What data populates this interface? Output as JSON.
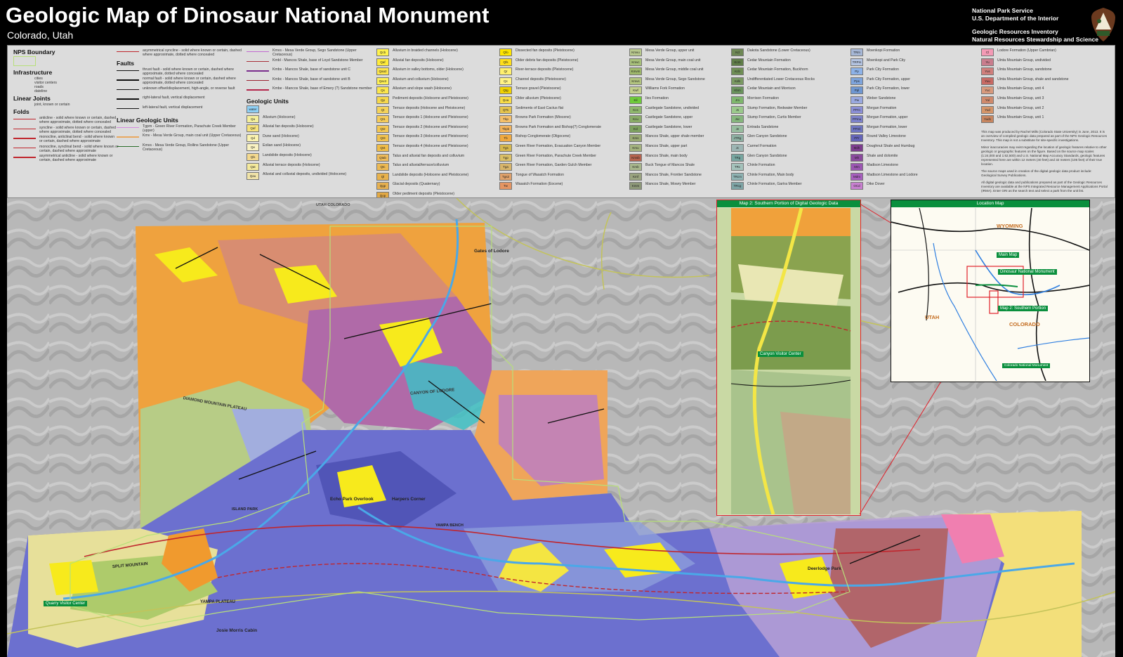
{
  "header": {
    "title": "Geologic Map of Dinosaur National Monument",
    "subtitle": "Colorado, Utah",
    "agency": [
      "National Park Service",
      "U.S. Department of the Interior",
      "",
      "Geologic Resources Inventory",
      "Natural Resources Stewardship and Science"
    ]
  },
  "legend": {
    "nps_boundary": "NPS Boundary",
    "infrastructure": "Infrastructure",
    "infra_items": [
      "cities",
      "visitor centers",
      "roads",
      "dateline"
    ],
    "linear_joints": "Linear Joints",
    "joint_item": "joint, known or certain",
    "folds": "Folds",
    "fold_items": [
      "anticline - solid where known or certain, dashed where approximate, dotted where concealed",
      "syncline - solid where known or certain, dashed where approximate, dotted where concealed",
      "monocline, anticlinal bend - solid where known or certain, dashed where approximate",
      "monocline, synclinal bend - solid where known or certain, dashed where approximate",
      "asymmetrical anticline - solid where known or certain, dashed where approximate"
    ],
    "fold_cont": "asymmetrical syncline - solid where known or certain, dashed where approximate, dotted where concealed",
    "faults": "Faults",
    "fault_items": [
      "thrust fault - solid where known or certain, dashed where approximate, dotted where concealed",
      "normal fault - solid where known or certain, dashed where approximate, dotted where concealed",
      "unknown offset/displacement, high-angle, or reverse fault",
      "right-lateral fault, vertical displacement",
      "left-lateral fault, vertical displacement"
    ],
    "linear_units": "Linear Geologic Units",
    "linear_unit_items": [
      "Tgpm - Green River Formation, Parachute Creek Member (upper)",
      "Kmv - Mesa Verde Group, main coal unit (Upper Cretaceous)",
      "Kmvs - Mesa Verde Group, Rollins Sandstone (Upper Cretaceous)"
    ],
    "col3_items": [
      "Kmvs - Mesa Verde Group, Sego Sandstone (Upper Cretaceous)",
      "Kmbl - Mancos Shale, base of Loyd Sandstone Member",
      "Kmbs - Mancos Shale, base of sandstone unit C",
      "Kmbc - Mancos Shale, base of sandstone unit B",
      "Kmbe - Mancos Shale, base of Emery (?) Sandstone member"
    ],
    "geologic_units": "Geologic Units",
    "water": "water",
    "units_a": [
      {
        "code": "Qa",
        "label": "Alluvium (Holocene)",
        "color": "#f5ef9b"
      },
      {
        "code": "Qaf",
        "label": "Alluvial fan deposits (Holocene)",
        "color": "#f7e37a"
      },
      {
        "code": "Qd",
        "label": "Dune sand (Holocene)",
        "color": "#fbf3b0"
      },
      {
        "code": "Qe",
        "label": "Eolian sand (Holocene)",
        "color": "#f9f2c2"
      },
      {
        "code": "Qls",
        "label": "Landslide deposits (Holocene)",
        "color": "#f3d98f"
      },
      {
        "code": "Qat",
        "label": "Alluvial terrace deposits (Holocene)",
        "color": "#f4e99c"
      },
      {
        "code": "Qau",
        "label": "Alluvial and colluvial deposits, undivided (Holocene)",
        "color": "#f0e3a8"
      }
    ],
    "units_b": [
      {
        "code": "Qcb",
        "label": "Alluvium in braided channels (Holocene)",
        "color": "#fff24d"
      },
      {
        "code": "Qaf",
        "label": "Alluvial fan deposits (Holocene)",
        "color": "#ffeb3b"
      },
      {
        "code": "Qaa2",
        "label": "Alluvium in valley bottoms, older (Holocene)",
        "color": "#fde54a"
      },
      {
        "code": "Qac2",
        "label": "Alluvium and colluvium (Holocene)",
        "color": "#fff055"
      },
      {
        "code": "Qs",
        "label": "Alluvium and slope wash (Holocene)",
        "color": "#fce64c"
      },
      {
        "code": "Qp",
        "label": "Pediment deposits (Holocene and Pleistocene)",
        "color": "#f6d84c"
      },
      {
        "code": "Qt",
        "label": "Terrace deposits (Holocene and Pleistocene)",
        "color": "#f5d35a"
      },
      {
        "code": "Qt1",
        "label": "Terrace deposits 1 (Holocene and Pleistocene)",
        "color": "#f6cc59"
      },
      {
        "code": "Qt2",
        "label": "Terrace deposits 2 (Holocene and Pleistocene)",
        "color": "#f4c752"
      },
      {
        "code": "Qt3",
        "label": "Terrace deposits 3 (Holocene and Pleistocene)",
        "color": "#f2c24e"
      },
      {
        "code": "Qt4",
        "label": "Terrace deposits 4 (Holocene and Pleistocene)",
        "color": "#f0bd48"
      },
      {
        "code": "Qtab",
        "label": "Talus and alluvial fan deposits and colluvium",
        "color": "#eebb5a"
      },
      {
        "code": "Qtc",
        "label": "Talus and alluvial/terrace/colluvium",
        "color": "#ecb953"
      },
      {
        "code": "Ql",
        "label": "Landslide deposits (Holocene and Pleistocene)",
        "color": "#e8b24c"
      },
      {
        "code": "Qgp",
        "label": "Glacial deposits (Quaternary)",
        "color": "#e6b050"
      },
      {
        "code": "Qop",
        "label": "Older pediment deposits (Pleistocene)",
        "color": "#e3a944"
      }
    ],
    "units_c": [
      {
        "code": "Qfo",
        "label": "Dissected fan deposits (Pleistocene)",
        "color": "#ffe500"
      },
      {
        "code": "Qfs",
        "label": "Older debris fan deposits (Pleistocene)",
        "color": "#ffdf1a"
      },
      {
        "code": "Qr",
        "label": "River-terrace deposits (Pleistocene)",
        "color": "#fff06e"
      },
      {
        "code": "Qc",
        "label": "Channel deposits (Pleistocene)",
        "color": "#fff385"
      },
      {
        "code": "Qtg",
        "label": "Terrace gravel (Pleistocene)",
        "color": "#f2d300"
      },
      {
        "code": "Qoa",
        "label": "Older alluvium (Pleistocene)",
        "color": "#f9dd46"
      },
      {
        "code": "QTs",
        "label": "Sediments of East Cactus flat",
        "color": "#e6c44d"
      },
      {
        "code": "Tbp",
        "label": "Browns Park Formation (Miocene)",
        "color": "#f6c06a"
      },
      {
        "code": "Tbpb",
        "label": "Browns Park Formation and Bishop(?) Conglomerate",
        "color": "#f3b35a"
      },
      {
        "code": "Tb",
        "label": "Bishop Conglomerate (Oligocene)",
        "color": "#f0a93f"
      },
      {
        "code": "Tgs",
        "label": "Green River Formation, Evacuation Canyon Member",
        "color": "#d6b84d"
      },
      {
        "code": "Tgp",
        "label": "Green River Formation, Parachute Creek Member",
        "color": "#dbc065"
      },
      {
        "code": "Tga",
        "label": "Green River Formation, Garden Gulch Member",
        "color": "#d8b56a"
      },
      {
        "code": "Tgs2",
        "label": "Tongue of Wasatch Formation",
        "color": "#e0a16a"
      },
      {
        "code": "Tw",
        "label": "Wasatch Formation (Eocene)",
        "color": "#e59562"
      }
    ],
    "units_d": [
      {
        "code": "Kmvu",
        "label": "Mesa Verde Group, upper unit",
        "color": "#b9c98e"
      },
      {
        "code": "Kmvc",
        "label": "Mesa Verde Group, main coal unit",
        "color": "#a8c17a"
      },
      {
        "code": "Kmvm",
        "label": "Mesa Verde Group, middle coal unit",
        "color": "#9fb96b"
      },
      {
        "code": "Kmvs",
        "label": "Mesa Verde Group, Sego Sandstone",
        "color": "#b2c47f"
      },
      {
        "code": "Kwf",
        "label": "Williams Fork Formation",
        "color": "#c2cf8c"
      },
      {
        "code": "Kil",
        "label": "Iles Formation",
        "color": "#6ecb3a"
      },
      {
        "code": "Kcs",
        "label": "Castlegate Sandstone, undivided",
        "color": "#8fb76d"
      },
      {
        "code": "Kcu",
        "label": "Castlegate Sandstone, upper",
        "color": "#8aac68"
      },
      {
        "code": "Kcl",
        "label": "Castlegate Sandstone, lower",
        "color": "#7ea160"
      },
      {
        "code": "Kms",
        "label": "Mancos Shale, upper shale member",
        "color": "#9aaa73"
      },
      {
        "code": "Kmu",
        "label": "Mancos Shale, upper part",
        "color": "#a4b37e"
      },
      {
        "code": "Kmsb",
        "label": "Mancos Shale, main body",
        "color": "#b6634e"
      },
      {
        "code": "Kmb",
        "label": "Buck Tongue of Mancos Shale",
        "color": "#a7b68b"
      },
      {
        "code": "Kmf",
        "label": "Mancos Shale, Frontier Sandstone",
        "color": "#9aa47f"
      },
      {
        "code": "Kmm",
        "label": "Mancos Shale, Mowry Member",
        "color": "#8d9878"
      }
    ],
    "units_e": [
      {
        "code": "Kd",
        "label": "Dakota Sandstone (Lower Cretaceous)",
        "color": "#6e8855"
      },
      {
        "code": "Kcm",
        "label": "Cedar Mountain Formation",
        "color": "#5f7d48"
      },
      {
        "code": "Kcb",
        "label": "Cedar Mountain Formation, Buckhorn",
        "color": "#6f8f55"
      },
      {
        "code": "Kdb",
        "label": "Undifferentiated Lower Cretaceous Rocks",
        "color": "#7a9a62"
      },
      {
        "code": "Kbm",
        "label": "Cedar Mountain and Morrison",
        "color": "#6a935c"
      },
      {
        "code": "Jm",
        "label": "Morrison Formation",
        "color": "#7fb76d"
      },
      {
        "code": "Js",
        "label": "Stump Formation, Redwater Member",
        "color": "#9bc98c"
      },
      {
        "code": "Jsc",
        "label": "Stump Formation, Curtis Member",
        "color": "#86b77d"
      },
      {
        "code": "Je",
        "label": "Entrada Sandstone",
        "color": "#97bd9e"
      },
      {
        "code": "JTRg",
        "label": "Glen Canyon Sandstone",
        "color": "#8db0a2"
      },
      {
        "code": "Jc",
        "label": "Carmel Formation",
        "color": "#9cb5b3"
      },
      {
        "code": "TRg",
        "label": "Glen Canyon Sandstone",
        "color": "#77a6a0"
      },
      {
        "code": "TRc",
        "label": "Chinle Formation",
        "color": "#a4c2bb"
      },
      {
        "code": "TRcm",
        "label": "Chinle Formation, Main body",
        "color": "#8fb4b4"
      },
      {
        "code": "TRcg",
        "label": "Chinle Formation, Gartra Member",
        "color": "#7fa5a6"
      }
    ],
    "units_f": [
      {
        "code": "TRm",
        "label": "Moenkopi Formation",
        "color": "#a6b7d6"
      },
      {
        "code": "TRPm",
        "label": "Moenkopi and Park City",
        "color": "#b4c4e2"
      },
      {
        "code": "Pp",
        "label": "Park City Formation",
        "color": "#8db2e8"
      },
      {
        "code": "Pps",
        "label": "Park City Formation, upper",
        "color": "#7ea4dc"
      },
      {
        "code": "Ppl",
        "label": "Park City Formation, lower",
        "color": "#6f97d2"
      },
      {
        "code": "Pw",
        "label": "Weber Sandstone",
        "color": "#9aa9e0"
      },
      {
        "code": "PPm",
        "label": "Morgan Formation",
        "color": "#8b8fd6"
      },
      {
        "code": "PPmu",
        "label": "Morgan Formation, upper",
        "color": "#7d82cc"
      },
      {
        "code": "PPml",
        "label": "Morgan Formation, lower",
        "color": "#6f75c2"
      },
      {
        "code": "PPr",
        "label": "Round Valley Limestone",
        "color": "#6464b8"
      },
      {
        "code": "Mdh",
        "label": "Doughnut Shale and Humbug",
        "color": "#7d3d8f"
      },
      {
        "code": "Mh",
        "label": "Shale and dolomite",
        "color": "#8b4a9e"
      },
      {
        "code": "Mm",
        "label": "Madison Limestone",
        "color": "#9b56b2"
      },
      {
        "code": "Mdm",
        "label": "Madison Limestone and Lodore",
        "color": "#a75fbe"
      },
      {
        "code": "OCd",
        "label": "Dike Dover",
        "color": "#c880d0"
      }
    ],
    "units_g": [
      {
        "code": "Cl",
        "label": "Lodore Formation (Upper Cambrian)",
        "color": "#f39ab5"
      },
      {
        "code": "Yu",
        "label": "Uinta Mountain Group, undivided",
        "color": "#c97d8d"
      },
      {
        "code": "Yus",
        "label": "Uinta Mountain Group, sandstone",
        "color": "#d07f7c"
      },
      {
        "code": "Yuu",
        "label": "Uinta Mountain Group, shale and sandstone",
        "color": "#c86a64"
      },
      {
        "code": "Yuc",
        "label": "Uinta Mountain Group, unit 4",
        "color": "#d89a7d"
      },
      {
        "code": "Yul",
        "label": "Uinta Mountain Group, unit 3",
        "color": "#cf8a6c"
      },
      {
        "code": "Yud",
        "label": "Uinta Mountain Group, unit 2",
        "color": "#d49569"
      },
      {
        "code": "Yud1",
        "label": "Uinta Mountain Group, unit 1",
        "color": "#c88660"
      }
    ],
    "notes": [
      "This map was produced by Rachel Mills (Colorado State University) in June, 2013. It is an overview of compiled geologic data prepared as part of the NPS Geologic Resources Inventory. This map is not a substitute for site-specific investigations.",
      "Minor inaccuracies may exist regarding the location of geologic features relative to other geologic or geographic features on the figure. Based on the source map scales (1:24,000 and 1:62,500) and U.S. National Map Accuracy Standards, geologic features represented here are within 12 meters (40 feet) and 32 meters (105 feet) of their true location.",
      "The source maps used in creation of the digital geologic data product include: Geological Survey Publications.",
      "All digital geologic data and publications prepared as part of the Geologic Resources Inventory are available at the NPS Integrated Resource Management Applications Portal (IRMA). Enter GRI as the search text and select a park from the unit list."
    ]
  },
  "map": {
    "inset_south_title": "Map 2: Southern Portion of Digital Geologic Data",
    "inset_location_title": "Location Map",
    "loc_labels": {
      "wyoming": "WYOMING",
      "utah": "UTAH",
      "colorado": "COLORADO",
      "main_map": "Main Map",
      "dnm": "Dinosaur National Monument",
      "map2": "Map 2: Southern Portion",
      "cnm": "Colorado National Monument"
    },
    "place_labels": {
      "gates_of_lodore": "Gates of Lodore",
      "canyon_of_lodore": "CANYON OF LODORE",
      "diamond_mountain": "DIAMOND MOUNTAIN PLATEAU",
      "echo_park": "Echo Park Overlook",
      "island_park": "ISLAND PARK",
      "split_mountain": "SPLIT MOUNTAIN",
      "yampa_plateau": "YAMPA PLATEAU",
      "quarry_vc": "Quarry Visitor Center",
      "canyon_vc": "Canyon Visitor Center",
      "josie_morris": "Josie Morris Cabin",
      "harpers_corner": "Harpers Corner",
      "deerlodge_park": "Deerlodge Park",
      "yampa_bench": "YAMPA BENCH",
      "utah_colorado": "UTAH  COLORADO"
    }
  }
}
